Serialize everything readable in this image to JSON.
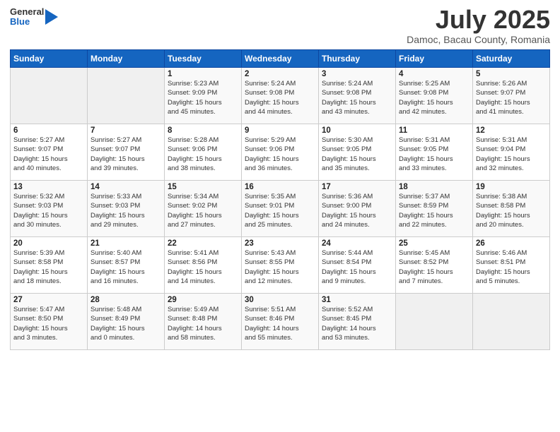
{
  "header": {
    "logo": {
      "line1": "General",
      "line2": "Blue"
    },
    "title": "July 2025",
    "subtitle": "Damoc, Bacau County, Romania"
  },
  "weekdays": [
    "Sunday",
    "Monday",
    "Tuesday",
    "Wednesday",
    "Thursday",
    "Friday",
    "Saturday"
  ],
  "weeks": [
    [
      {
        "day": "",
        "info": ""
      },
      {
        "day": "",
        "info": ""
      },
      {
        "day": "1",
        "info": "Sunrise: 5:23 AM\nSunset: 9:09 PM\nDaylight: 15 hours\nand 45 minutes."
      },
      {
        "day": "2",
        "info": "Sunrise: 5:24 AM\nSunset: 9:08 PM\nDaylight: 15 hours\nand 44 minutes."
      },
      {
        "day": "3",
        "info": "Sunrise: 5:24 AM\nSunset: 9:08 PM\nDaylight: 15 hours\nand 43 minutes."
      },
      {
        "day": "4",
        "info": "Sunrise: 5:25 AM\nSunset: 9:08 PM\nDaylight: 15 hours\nand 42 minutes."
      },
      {
        "day": "5",
        "info": "Sunrise: 5:26 AM\nSunset: 9:07 PM\nDaylight: 15 hours\nand 41 minutes."
      }
    ],
    [
      {
        "day": "6",
        "info": "Sunrise: 5:27 AM\nSunset: 9:07 PM\nDaylight: 15 hours\nand 40 minutes."
      },
      {
        "day": "7",
        "info": "Sunrise: 5:27 AM\nSunset: 9:07 PM\nDaylight: 15 hours\nand 39 minutes."
      },
      {
        "day": "8",
        "info": "Sunrise: 5:28 AM\nSunset: 9:06 PM\nDaylight: 15 hours\nand 38 minutes."
      },
      {
        "day": "9",
        "info": "Sunrise: 5:29 AM\nSunset: 9:06 PM\nDaylight: 15 hours\nand 36 minutes."
      },
      {
        "day": "10",
        "info": "Sunrise: 5:30 AM\nSunset: 9:05 PM\nDaylight: 15 hours\nand 35 minutes."
      },
      {
        "day": "11",
        "info": "Sunrise: 5:31 AM\nSunset: 9:05 PM\nDaylight: 15 hours\nand 33 minutes."
      },
      {
        "day": "12",
        "info": "Sunrise: 5:31 AM\nSunset: 9:04 PM\nDaylight: 15 hours\nand 32 minutes."
      }
    ],
    [
      {
        "day": "13",
        "info": "Sunrise: 5:32 AM\nSunset: 9:03 PM\nDaylight: 15 hours\nand 30 minutes."
      },
      {
        "day": "14",
        "info": "Sunrise: 5:33 AM\nSunset: 9:03 PM\nDaylight: 15 hours\nand 29 minutes."
      },
      {
        "day": "15",
        "info": "Sunrise: 5:34 AM\nSunset: 9:02 PM\nDaylight: 15 hours\nand 27 minutes."
      },
      {
        "day": "16",
        "info": "Sunrise: 5:35 AM\nSunset: 9:01 PM\nDaylight: 15 hours\nand 25 minutes."
      },
      {
        "day": "17",
        "info": "Sunrise: 5:36 AM\nSunset: 9:00 PM\nDaylight: 15 hours\nand 24 minutes."
      },
      {
        "day": "18",
        "info": "Sunrise: 5:37 AM\nSunset: 8:59 PM\nDaylight: 15 hours\nand 22 minutes."
      },
      {
        "day": "19",
        "info": "Sunrise: 5:38 AM\nSunset: 8:58 PM\nDaylight: 15 hours\nand 20 minutes."
      }
    ],
    [
      {
        "day": "20",
        "info": "Sunrise: 5:39 AM\nSunset: 8:58 PM\nDaylight: 15 hours\nand 18 minutes."
      },
      {
        "day": "21",
        "info": "Sunrise: 5:40 AM\nSunset: 8:57 PM\nDaylight: 15 hours\nand 16 minutes."
      },
      {
        "day": "22",
        "info": "Sunrise: 5:41 AM\nSunset: 8:56 PM\nDaylight: 15 hours\nand 14 minutes."
      },
      {
        "day": "23",
        "info": "Sunrise: 5:43 AM\nSunset: 8:55 PM\nDaylight: 15 hours\nand 12 minutes."
      },
      {
        "day": "24",
        "info": "Sunrise: 5:44 AM\nSunset: 8:54 PM\nDaylight: 15 hours\nand 9 minutes."
      },
      {
        "day": "25",
        "info": "Sunrise: 5:45 AM\nSunset: 8:52 PM\nDaylight: 15 hours\nand 7 minutes."
      },
      {
        "day": "26",
        "info": "Sunrise: 5:46 AM\nSunset: 8:51 PM\nDaylight: 15 hours\nand 5 minutes."
      }
    ],
    [
      {
        "day": "27",
        "info": "Sunrise: 5:47 AM\nSunset: 8:50 PM\nDaylight: 15 hours\nand 3 minutes."
      },
      {
        "day": "28",
        "info": "Sunrise: 5:48 AM\nSunset: 8:49 PM\nDaylight: 15 hours\nand 0 minutes."
      },
      {
        "day": "29",
        "info": "Sunrise: 5:49 AM\nSunset: 8:48 PM\nDaylight: 14 hours\nand 58 minutes."
      },
      {
        "day": "30",
        "info": "Sunrise: 5:51 AM\nSunset: 8:46 PM\nDaylight: 14 hours\nand 55 minutes."
      },
      {
        "day": "31",
        "info": "Sunrise: 5:52 AM\nSunset: 8:45 PM\nDaylight: 14 hours\nand 53 minutes."
      },
      {
        "day": "",
        "info": ""
      },
      {
        "day": "",
        "info": ""
      }
    ]
  ]
}
